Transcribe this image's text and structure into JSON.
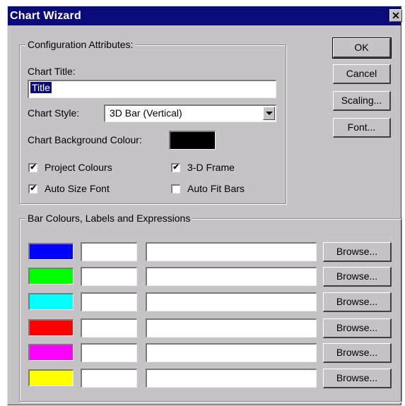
{
  "window": {
    "title": "Chart Wizard",
    "close_glyph": "✕"
  },
  "config_group": {
    "label": "Configuration Attributes:",
    "chart_title_label": "Chart Title:",
    "chart_title_value": "Title",
    "chart_style_label": "Chart Style:",
    "chart_style_value": "3D Bar (Vertical)",
    "background_label": "Chart Background Colour:",
    "background_color": "#000000",
    "checkboxes": [
      {
        "label": "Project Colours",
        "checked": true
      },
      {
        "label": "3-D Frame",
        "checked": true
      },
      {
        "label": "Auto Size Font",
        "checked": true
      },
      {
        "label": "Auto Fit Bars",
        "checked": false
      }
    ]
  },
  "buttons": {
    "ok": "OK",
    "cancel": "Cancel",
    "scaling": "Scaling...",
    "font": "Font..."
  },
  "bars_group": {
    "label": "Bar Colours, Labels and Expressions",
    "rows": [
      {
        "color": "#0000ff",
        "label": "",
        "expression": "",
        "browse": "Browse..."
      },
      {
        "color": "#00ff00",
        "label": "",
        "expression": "",
        "browse": "Browse..."
      },
      {
        "color": "#00ffff",
        "label": "",
        "expression": "",
        "browse": "Browse..."
      },
      {
        "color": "#ff0000",
        "label": "",
        "expression": "",
        "browse": "Browse..."
      },
      {
        "color": "#ff00ff",
        "label": "",
        "expression": "",
        "browse": "Browse..."
      },
      {
        "color": "#ffff00",
        "label": "",
        "expression": "",
        "browse": "Browse..."
      }
    ]
  }
}
